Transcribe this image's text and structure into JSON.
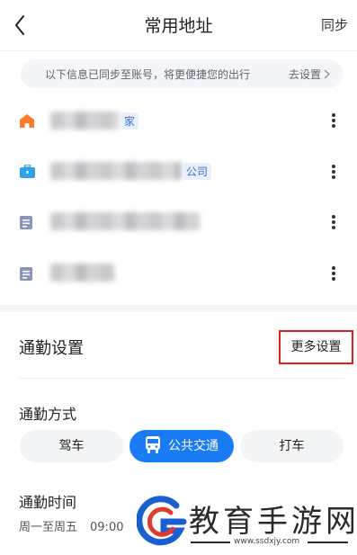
{
  "header": {
    "title": "常用地址",
    "sync_label": "同步"
  },
  "banner": {
    "text": "以下信息已同步至账号，将更便捷您的出行",
    "link_label": "去设置"
  },
  "addresses": [
    {
      "tag": "家",
      "icon": "home-icon",
      "icon_color": "#ff7a2e"
    },
    {
      "tag": "公司",
      "icon": "briefcase-icon",
      "icon_color": "#2fa3e8"
    },
    {
      "tag": "",
      "icon": "document-icon",
      "icon_color": "#8a93b8"
    },
    {
      "tag": "",
      "icon": "document-icon",
      "icon_color": "#8a93b8"
    }
  ],
  "commute": {
    "title": "通勤设置",
    "more_settings": "更多设置",
    "mode_label": "通勤方式",
    "modes": [
      "驾车",
      "公共交通",
      "打车"
    ],
    "selected_mode": "公共交通",
    "time_label": "通勤时间",
    "days": "周一至周五",
    "time": "09:00"
  },
  "colors": {
    "accent": "#1a7cf5",
    "highlight_border": "#e02020",
    "tag_text": "#3a6fd8",
    "tag_bg": "#e8f0fd"
  },
  "watermark": {
    "text": "教育手游网",
    "url": "www.ssdxjy.com"
  }
}
